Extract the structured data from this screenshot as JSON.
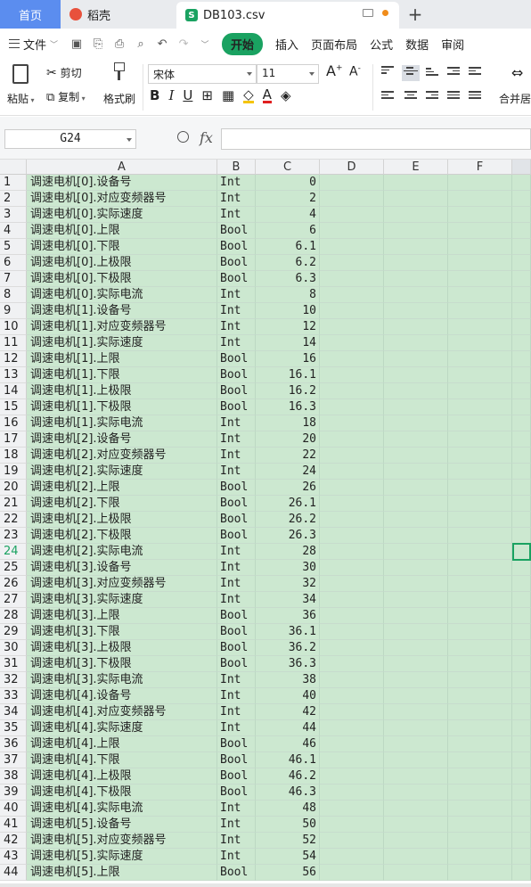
{
  "tabs": {
    "home": "首页",
    "daoke": "稻壳",
    "file": "DB103.csv",
    "add": "+"
  },
  "menu": {
    "file": "文件",
    "items": [
      "开始",
      "插入",
      "页面布局",
      "公式",
      "数据",
      "审阅"
    ]
  },
  "ribbon": {
    "paste": "粘贴",
    "cut": "剪切",
    "copy": "复制",
    "format_painter": "格式刷",
    "font_name": "宋体",
    "font_size": "11",
    "bold": "B",
    "italic": "I",
    "underline": "U",
    "merge": "合并居"
  },
  "formula_bar": {
    "name_box": "G24",
    "fx": "fx",
    "content": ""
  },
  "columns": [
    "A",
    "B",
    "C",
    "D",
    "E",
    "F"
  ],
  "active_row": 24,
  "rows": [
    {
      "n": "1",
      "a": "调速电机[0].设备号",
      "b": "Int",
      "c": "0"
    },
    {
      "n": "2",
      "a": "调速电机[0].对应变频器号",
      "b": "Int",
      "c": "2"
    },
    {
      "n": "3",
      "a": "调速电机[0].实际速度",
      "b": "Int",
      "c": "4"
    },
    {
      "n": "4",
      "a": "调速电机[0].上限",
      "b": "Bool",
      "c": "6"
    },
    {
      "n": "5",
      "a": "调速电机[0].下限",
      "b": "Bool",
      "c": "6.1"
    },
    {
      "n": "6",
      "a": "调速电机[0].上极限",
      "b": "Bool",
      "c": "6.2"
    },
    {
      "n": "7",
      "a": "调速电机[0].下极限",
      "b": "Bool",
      "c": "6.3"
    },
    {
      "n": "8",
      "a": "调速电机[0].实际电流",
      "b": "Int",
      "c": "8"
    },
    {
      "n": "9",
      "a": "调速电机[1].设备号",
      "b": "Int",
      "c": "10"
    },
    {
      "n": "10",
      "a": "调速电机[1].对应变频器号",
      "b": "Int",
      "c": "12"
    },
    {
      "n": "11",
      "a": "调速电机[1].实际速度",
      "b": "Int",
      "c": "14"
    },
    {
      "n": "12",
      "a": "调速电机[1].上限",
      "b": "Bool",
      "c": "16"
    },
    {
      "n": "13",
      "a": "调速电机[1].下限",
      "b": "Bool",
      "c": "16.1"
    },
    {
      "n": "14",
      "a": "调速电机[1].上极限",
      "b": "Bool",
      "c": "16.2"
    },
    {
      "n": "15",
      "a": "调速电机[1].下极限",
      "b": "Bool",
      "c": "16.3"
    },
    {
      "n": "16",
      "a": "调速电机[1].实际电流",
      "b": "Int",
      "c": "18"
    },
    {
      "n": "17",
      "a": "调速电机[2].设备号",
      "b": "Int",
      "c": "20"
    },
    {
      "n": "18",
      "a": "调速电机[2].对应变频器号",
      "b": "Int",
      "c": "22"
    },
    {
      "n": "19",
      "a": "调速电机[2].实际速度",
      "b": "Int",
      "c": "24"
    },
    {
      "n": "20",
      "a": "调速电机[2].上限",
      "b": "Bool",
      "c": "26"
    },
    {
      "n": "21",
      "a": "调速电机[2].下限",
      "b": "Bool",
      "c": "26.1"
    },
    {
      "n": "22",
      "a": "调速电机[2].上极限",
      "b": "Bool",
      "c": "26.2"
    },
    {
      "n": "23",
      "a": "调速电机[2].下极限",
      "b": "Bool",
      "c": "26.3"
    },
    {
      "n": "24",
      "a": "调速电机[2].实际电流",
      "b": "Int",
      "c": "28"
    },
    {
      "n": "25",
      "a": "调速电机[3].设备号",
      "b": "Int",
      "c": "30"
    },
    {
      "n": "26",
      "a": "调速电机[3].对应变频器号",
      "b": "Int",
      "c": "32"
    },
    {
      "n": "27",
      "a": "调速电机[3].实际速度",
      "b": "Int",
      "c": "34"
    },
    {
      "n": "28",
      "a": "调速电机[3].上限",
      "b": "Bool",
      "c": "36"
    },
    {
      "n": "29",
      "a": "调速电机[3].下限",
      "b": "Bool",
      "c": "36.1"
    },
    {
      "n": "30",
      "a": "调速电机[3].上极限",
      "b": "Bool",
      "c": "36.2"
    },
    {
      "n": "31",
      "a": "调速电机[3].下极限",
      "b": "Bool",
      "c": "36.3"
    },
    {
      "n": "32",
      "a": "调速电机[3].实际电流",
      "b": "Int",
      "c": "38"
    },
    {
      "n": "33",
      "a": "调速电机[4].设备号",
      "b": "Int",
      "c": "40"
    },
    {
      "n": "34",
      "a": "调速电机[4].对应变频器号",
      "b": "Int",
      "c": "42"
    },
    {
      "n": "35",
      "a": "调速电机[4].实际速度",
      "b": "Int",
      "c": "44"
    },
    {
      "n": "36",
      "a": "调速电机[4].上限",
      "b": "Bool",
      "c": "46"
    },
    {
      "n": "37",
      "a": "调速电机[4].下限",
      "b": "Bool",
      "c": "46.1"
    },
    {
      "n": "38",
      "a": "调速电机[4].上极限",
      "b": "Bool",
      "c": "46.2"
    },
    {
      "n": "39",
      "a": "调速电机[4].下极限",
      "b": "Bool",
      "c": "46.3"
    },
    {
      "n": "40",
      "a": "调速电机[4].实际电流",
      "b": "Int",
      "c": "48"
    },
    {
      "n": "41",
      "a": "调速电机[5].设备号",
      "b": "Int",
      "c": "50"
    },
    {
      "n": "42",
      "a": "调速电机[5].对应变频器号",
      "b": "Int",
      "c": "52"
    },
    {
      "n": "43",
      "a": "调速电机[5].实际速度",
      "b": "Int",
      "c": "54"
    },
    {
      "n": "44",
      "a": "调速电机[5].上限",
      "b": "Bool",
      "c": "56"
    }
  ]
}
